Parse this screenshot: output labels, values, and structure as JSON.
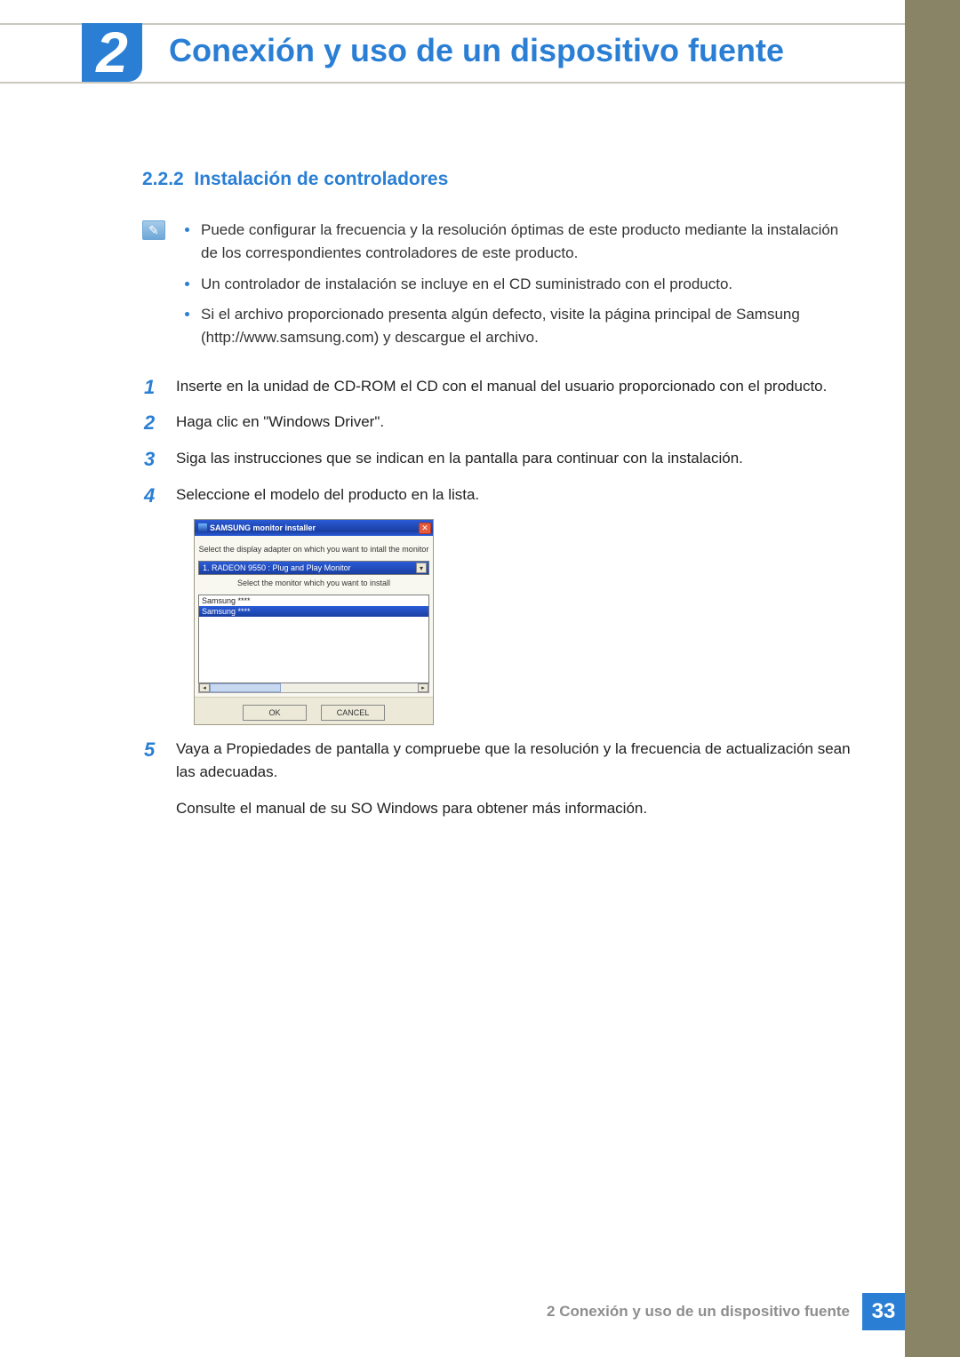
{
  "chapter": {
    "number": "2",
    "title": "Conexión y uso de un dispositivo fuente"
  },
  "section": {
    "number": "2.2.2",
    "title": "Instalación de controladores"
  },
  "notes": [
    "Puede configurar la frecuencia y la resolución óptimas de este producto mediante la instalación de los correspondientes controladores de este producto.",
    "Un controlador de instalación se incluye en el CD suministrado con el producto.",
    "Si el archivo proporcionado presenta algún defecto, visite la página principal de Samsung (http://www.samsung.com) y descargue el archivo."
  ],
  "steps": [
    {
      "n": "1",
      "text": "Inserte en la unidad de CD-ROM el CD con el manual del usuario proporcionado con el producto."
    },
    {
      "n": "2",
      "text": "Haga clic en \"Windows Driver\"."
    },
    {
      "n": "3",
      "text": "Siga las instrucciones que se indican en la pantalla para continuar con la instalación."
    },
    {
      "n": "4",
      "text": "Seleccione el modelo del producto en la lista."
    }
  ],
  "step5": {
    "n": "5",
    "text": "Vaya a Propiedades de pantalla y compruebe que la resolución y la frecuencia de actualización sean las adecuadas.",
    "extra": "Consulte el manual de su SO Windows para obtener más información."
  },
  "installer": {
    "title": "SAMSUNG monitor installer",
    "msg1": "Select the display adapter on which you want to intall the monitor",
    "dropdown": "1. RADEON 9550 : Plug and Play Monitor",
    "msg2": "Select the monitor which you want to install",
    "list": [
      "Samsung ****",
      "Samsung ****"
    ],
    "ok": "OK",
    "cancel": "CANCEL"
  },
  "footer": {
    "label": "2 Conexión y uso de un dispositivo fuente",
    "page": "33"
  }
}
